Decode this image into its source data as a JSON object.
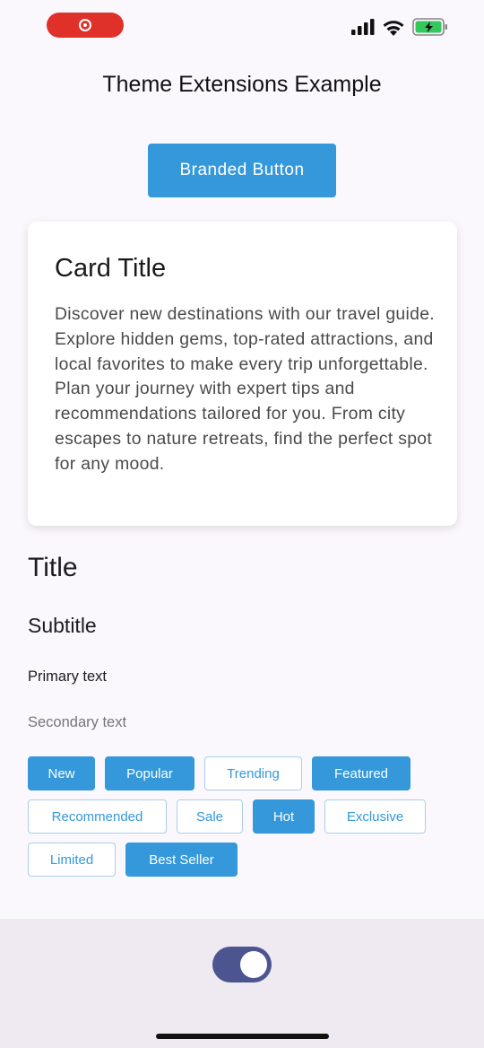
{
  "app": {
    "title": "Theme Extensions Example"
  },
  "branded_button": {
    "label": "Branded Button"
  },
  "card": {
    "title": "Card Title",
    "body": "Discover new destinations with our travel guide. Explore hidden gems, top-rated attractions, and local favorites to make every trip unforgettable. Plan your journey with expert tips and recommendations tailored for you. From city escapes to nature retreats, find the perfect spot for any mood."
  },
  "typography": {
    "title": "Title",
    "subtitle": "Subtitle",
    "primary": "Primary text",
    "secondary": "Secondary text"
  },
  "chips": [
    {
      "label": "New",
      "style": "filled"
    },
    {
      "label": "Popular",
      "style": "filled"
    },
    {
      "label": "Trending",
      "style": "outline"
    },
    {
      "label": "Featured",
      "style": "filled"
    },
    {
      "label": "Recommended",
      "style": "outline"
    },
    {
      "label": "Sale",
      "style": "outline"
    },
    {
      "label": "Hot",
      "style": "filled"
    },
    {
      "label": "Exclusive",
      "style": "outline"
    },
    {
      "label": "Limited",
      "style": "outline"
    },
    {
      "label": "Best Seller",
      "style": "filled"
    }
  ],
  "toggle": {
    "on": true
  },
  "colors": {
    "brand": "#3498db",
    "record": "#e0302a",
    "toggle_track": "#4d5590",
    "battery": "#34c759"
  },
  "icons": [
    "record-icon",
    "cellular-signal-icon",
    "wifi-icon",
    "battery-charging-icon"
  ]
}
